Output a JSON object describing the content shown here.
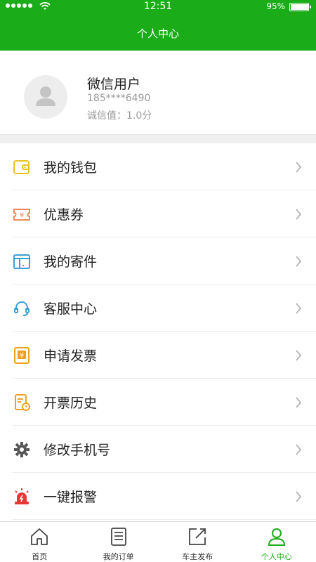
{
  "status_bar": {
    "time": "12:51",
    "battery": "95%",
    "battery_level": 0.95
  },
  "header": {
    "title": "个人中心"
  },
  "profile": {
    "name": "微信用户",
    "phone": "185****6490",
    "credit": "诚信值：1.0分"
  },
  "menu": [
    {
      "label": "我的钱包",
      "icon": "wallet-icon",
      "color": "#e8c21f"
    },
    {
      "label": "优惠券",
      "icon": "coupon-icon",
      "color": "#f08a5d"
    },
    {
      "label": "我的寄件",
      "icon": "package-icon",
      "color": "#3a9fd6"
    },
    {
      "label": "客服中心",
      "icon": "headset-icon",
      "color": "#3a9fd6"
    },
    {
      "label": "申请发票",
      "icon": "invoice-icon",
      "color": "#f0a020"
    },
    {
      "label": "开票历史",
      "icon": "invoice-history-icon",
      "color": "#f0a020"
    },
    {
      "label": "修改手机号",
      "icon": "gear-icon",
      "color": "#555555"
    },
    {
      "label": "一键报警",
      "icon": "alarm-icon",
      "color": "#e53935"
    }
  ],
  "tabs": [
    {
      "label": "首页",
      "icon": "home-icon"
    },
    {
      "label": "我的订单",
      "icon": "orders-icon"
    },
    {
      "label": "车主发布",
      "icon": "publish-icon"
    },
    {
      "label": "个人中心",
      "icon": "profile-icon",
      "active": true
    }
  ],
  "colors": {
    "brand": "#1aad19",
    "background_gap": "#efefef"
  }
}
